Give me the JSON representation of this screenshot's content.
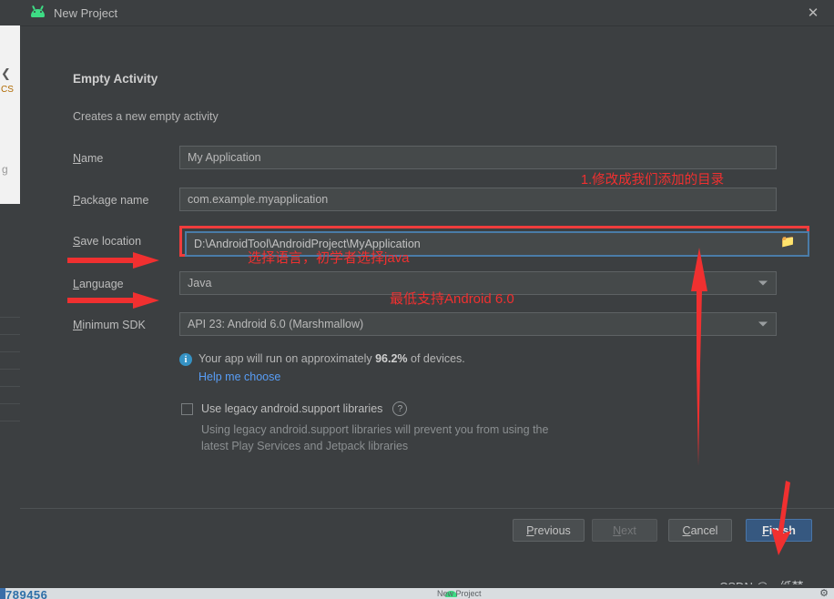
{
  "window": {
    "title": "New Project",
    "app_icon": "android-robot-icon",
    "close_label": "✕"
  },
  "dialog": {
    "section_title": "Empty Activity",
    "section_subtitle": "Creates a new empty activity"
  },
  "fields": [
    {
      "id": "name",
      "label": "Name",
      "mnemonic": "N",
      "value": "My Application"
    },
    {
      "id": "package",
      "label": "Package name",
      "mnemonic": "P",
      "value": "com.example.myapplication"
    },
    {
      "id": "save",
      "label": "Save location",
      "mnemonic": "S",
      "value": "D:\\AndroidTool\\AndroidProject\\MyApplication"
    },
    {
      "id": "language",
      "label": "Language",
      "mnemonic": "L",
      "value": "Java"
    },
    {
      "id": "minimum_sdk",
      "label": "Minimum SDK",
      "mnemonic": "M",
      "value": "API 23: Android 6.0 (Marshmallow)"
    }
  ],
  "info": {
    "prefix": "Your app will run on approximately ",
    "percent": "96.2%",
    "suffix": " of devices.",
    "link": "Help me choose",
    "icon": "info-icon"
  },
  "legacy": {
    "checked": false,
    "label": "Use legacy android.support libraries",
    "help_glyph": "?",
    "description": "Using legacy android.support libraries will prevent you from using the latest Play Services and Jetpack libraries"
  },
  "footer": {
    "buttons": [
      {
        "id": "previous",
        "label": "Previous",
        "mnemonic": "P",
        "state": "enabled"
      },
      {
        "id": "next",
        "label": "Next",
        "mnemonic": "N",
        "state": "disabled"
      },
      {
        "id": "cancel",
        "label": "Cancel",
        "mnemonic": "C",
        "state": "enabled"
      },
      {
        "id": "finish",
        "label": "Finish",
        "mnemonic": "F",
        "state": "primary"
      }
    ]
  },
  "annotations": {
    "color": "#f03030",
    "save_location": "1.修改成我们添加的目录",
    "language": "选择语言，初学者选择java",
    "minimum_sdk": "最低支持Android 6.0"
  },
  "watermark": "CSDN @一纸梦",
  "background": {
    "taskbar_number": "789456",
    "taskbar_item": "New Project",
    "browser_glyphs": [
      "❮",
      "CS",
      "g"
    ],
    "right_edge_text": "SDN"
  }
}
